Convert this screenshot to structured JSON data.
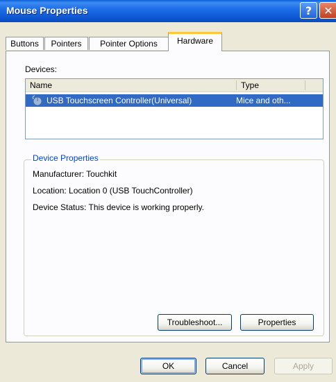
{
  "window": {
    "title": "Mouse Properties",
    "help_glyph": "?",
    "close_glyph": "✕"
  },
  "tabs": [
    {
      "label": "Buttons",
      "active": false
    },
    {
      "label": "Pointers",
      "active": false
    },
    {
      "label": "Pointer Options",
      "active": false
    },
    {
      "label": "Hardware",
      "active": true
    }
  ],
  "devices": {
    "label": "Devices:",
    "columns": [
      "Name",
      "Type"
    ],
    "rows": [
      {
        "name": "USB Touchscreen Controller(Universal)",
        "type": "Mice and oth...",
        "icon": "mouse-icon",
        "selected": true
      }
    ]
  },
  "device_properties": {
    "legend": "Device Properties",
    "manufacturer": "Manufacturer: Touchkit",
    "location": "Location: Location 0 (USB TouchController)",
    "status": "Device Status: This device is working properly.",
    "troubleshoot_label": "Troubleshoot...",
    "properties_label": "Properties"
  },
  "footer": {
    "ok_label": "OK",
    "cancel_label": "Cancel",
    "apply_label": "Apply"
  },
  "colors": {
    "title_bar": "#1e6ee8",
    "selection": "#316ac5",
    "active_tab_accent": "#ffc83c",
    "group_legend": "#0046d5",
    "dialog_background": "#ece9d8"
  }
}
